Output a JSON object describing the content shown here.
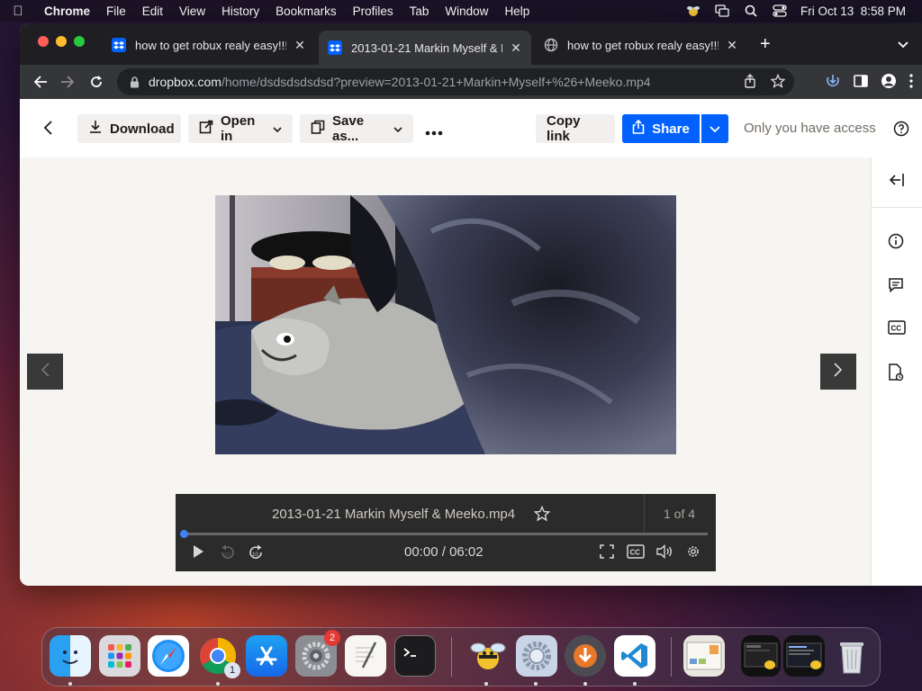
{
  "menubar": {
    "app_name": "Chrome",
    "items": [
      "File",
      "Edit",
      "View",
      "History",
      "Bookmarks",
      "Profiles",
      "Tab",
      "Window",
      "Help"
    ],
    "clock": "Fri Oct 13  8:58 PM"
  },
  "browser": {
    "tabs": [
      {
        "title": "how to get robux realy easy!!!",
        "favicon": "dropbox-icon"
      },
      {
        "title": "2013-01-21 Markin Myself & M",
        "favicon": "dropbox-icon"
      },
      {
        "title": "how to get robux realy easy!!!",
        "favicon": "globe-icon"
      }
    ],
    "url_host": "dropbox.com",
    "url_path": "/home/dsdsdsdsdsd?preview=2013-01-21+Markin+Myself+%26+Meeko.mp4"
  },
  "dropbox": {
    "download_label": "Download",
    "open_in_label": "Open in",
    "save_as_label": "Save as...",
    "copy_link_label": "Copy link",
    "share_label": "Share",
    "access_text": "Only you have access",
    "accent_color": "#0061fe"
  },
  "player": {
    "file_name": "2013-01-21 Markin Myself & Meeko.mp4",
    "counter": "1 of 4",
    "current_time": "00:00",
    "time_separator": "/",
    "duration": "06:02",
    "progress": 0
  },
  "dock": {
    "apps": [
      "Finder",
      "Launchpad",
      "Safari",
      "Google Chrome",
      "App Store",
      "System Settings",
      "TextEdit",
      "Terminal",
      "Cyberduck",
      "System Preferences",
      "Transmission",
      "Visual Studio Code",
      "Preview",
      "Screenshots",
      "Trash"
    ],
    "system_settings_badge": "2",
    "chrome_badge": "1"
  }
}
